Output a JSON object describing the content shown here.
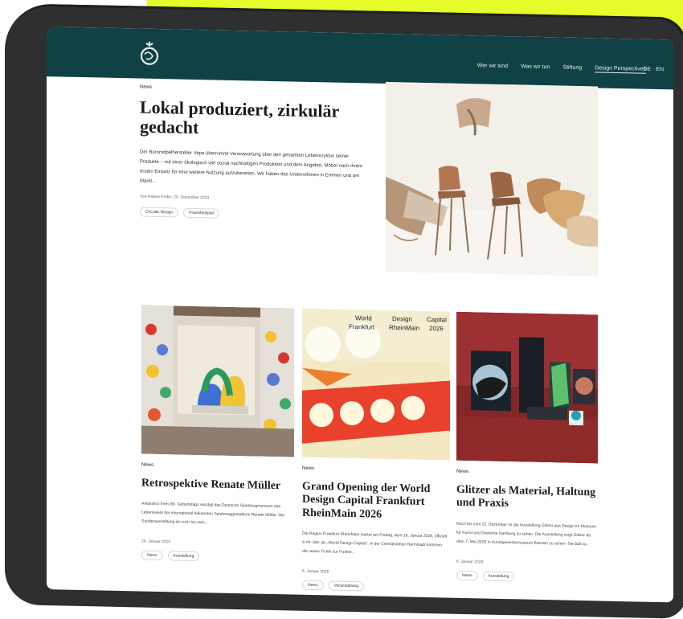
{
  "nav": {
    "links": [
      "Wer wir sind",
      "Was wir tun",
      "Stiftung",
      "Design Perspectives"
    ],
    "language": "DE · EN"
  },
  "hero": {
    "eyebrow": "News",
    "title": "Lokal produziert, zirkulär gedacht",
    "text": "Der Büromöbelhersteller Vepa übernimmt Verantwortung über den gesamten Lebenszyklus seiner Produkte – mit einer ökologisch wie sozial nachhaltigen Produktion und dem Angebot, Möbel nach ihrem ersten Einsatz für eine weitere Nutzung aufzubereiten. Wir haben das Unternehmen in Emmen und am Markt...",
    "meta": "Von Rabea Prüfer, 20. Dezember 2024",
    "tags": [
      "Circular Design",
      "Praxisbeispiel"
    ]
  },
  "cards": [
    {
      "eyebrow": "News",
      "title": "Retrospektive Renate Müller",
      "text": "Anlässlich ihres 80. Geburtstags würdigt das Deutsche Spielzeugmuseum das Lebenswerk der international bekannten Spielzeuggestalterin Renate Müller. Die Sonderausstellung ist noch bis zum...",
      "meta": "20. Januar 2025",
      "tags": [
        "News",
        "Ausstellung"
      ]
    },
    {
      "eyebrow": "News",
      "title": "Grand Opening der World Design Capital Frankfurt RheinMain 2026",
      "text": "Die Region Frankfurt RheinMain startet am Freitag, dem 16. Januar 2026, offiziell in ihr Jahr als „World Design Capital“. In der Centralstation Darmstadt kommen die neuen Ticket zur Punkte...",
      "meta": "6. Januar 2026",
      "tags": [
        "News",
        "Veranstaltung"
      ]
    },
    {
      "eyebrow": "News",
      "title": "Glitzer als Material, Haltung und Praxis",
      "text": "Noch bis zum 12. Dezember ist die Ausstellung Glitzer aus Design im Museum für Kunst und Gewerbe Hamburg zu sehen. Die Ausstellung zeigt Glitzer ab dem 7. Mai 2026 in Kunstgewerbemuseum Bremen zu sehen. Sie lädt zu...",
      "meta": "6. Januar 2026",
      "tags": [
        "News",
        "Ausstellung"
      ]
    }
  ],
  "worldDesignPoster": {
    "line1": [
      "World",
      "Design",
      "Capital"
    ],
    "line2": [
      "Frankfurt",
      "RheinMain",
      "2026"
    ]
  },
  "colors": {
    "yellow": "#e6fb2a",
    "nav": "#0f4145",
    "bezel": "#2e2f31"
  }
}
